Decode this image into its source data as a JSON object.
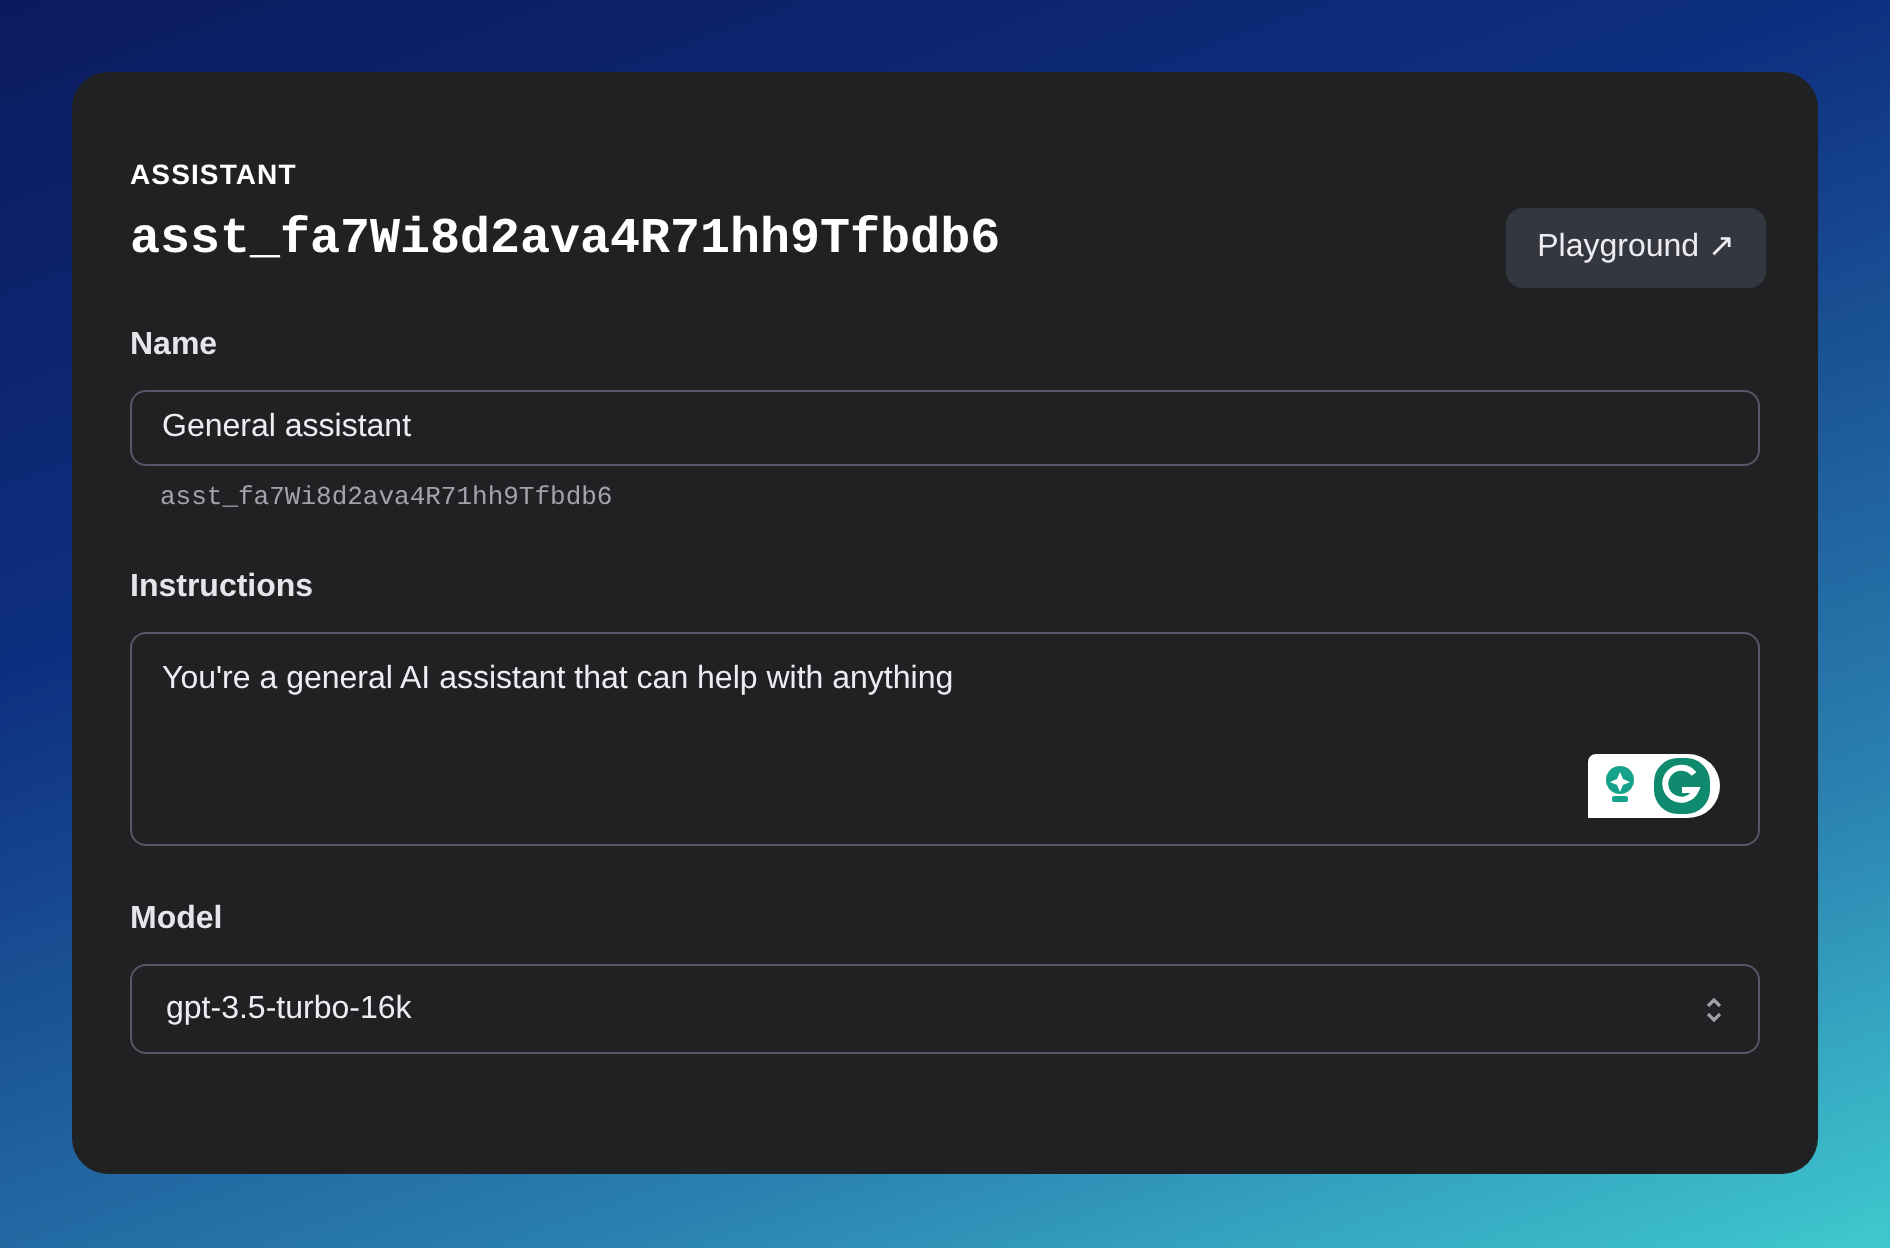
{
  "header": {
    "eyebrow": "ASSISTANT",
    "title": "asst_fa7Wi8d2ava4R71hh9Tfbdb6",
    "playground_button": "Playground ↗"
  },
  "fields": [
    {
      "kind": "input",
      "label": "Name",
      "value": "General assistant",
      "hint": "asst_fa7Wi8d2ava4R71hh9Tfbdb6"
    },
    {
      "kind": "textarea",
      "label": "Instructions",
      "value": "You're a general AI assistant that can help with anything"
    },
    {
      "kind": "select",
      "label": "Model",
      "value": "gpt-3.5-turbo-16k"
    }
  ]
}
